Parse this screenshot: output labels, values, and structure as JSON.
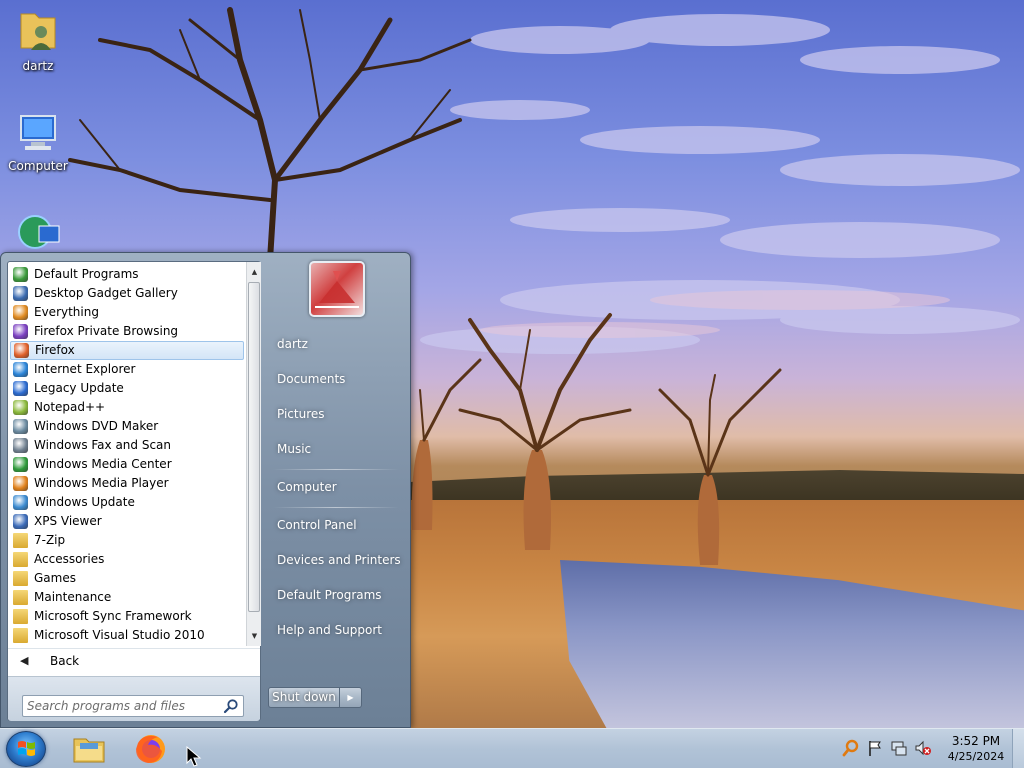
{
  "desktop": {
    "icons": [
      {
        "label": "dartz",
        "icon": "user-folder-icon"
      },
      {
        "label": "Computer",
        "icon": "computer-icon"
      },
      {
        "label": "",
        "icon": "network-icon"
      }
    ]
  },
  "start_menu": {
    "programs": [
      {
        "label": "Default Programs",
        "icon": "default-programs-icon",
        "color": "#3a9a3a"
      },
      {
        "label": "Desktop Gadget Gallery",
        "icon": "gadget-gallery-icon",
        "color": "#3a6ab0"
      },
      {
        "label": "Everything",
        "icon": "everything-search-icon",
        "color": "#e08a20"
      },
      {
        "label": "Firefox Private Browsing",
        "icon": "firefox-private-icon",
        "color": "#7a3fc0"
      },
      {
        "label": "Firefox",
        "icon": "firefox-icon",
        "color": "#e0602a",
        "selected": true
      },
      {
        "label": "Internet Explorer",
        "icon": "internet-explorer-icon",
        "color": "#2a84d8"
      },
      {
        "label": "Legacy Update",
        "icon": "legacy-update-icon",
        "color": "#2a6ad0"
      },
      {
        "label": "Notepad++",
        "icon": "notepadpp-icon",
        "color": "#8ab83a"
      },
      {
        "label": "Windows DVD Maker",
        "icon": "dvd-maker-icon",
        "color": "#6a8aa0"
      },
      {
        "label": "Windows Fax and Scan",
        "icon": "fax-scan-icon",
        "color": "#708090"
      },
      {
        "label": "Windows Media Center",
        "icon": "media-center-icon",
        "color": "#2e9a3a"
      },
      {
        "label": "Windows Media Player",
        "icon": "media-player-icon",
        "color": "#e0801a"
      },
      {
        "label": "Windows Update",
        "icon": "windows-update-icon",
        "color": "#3a8ad0"
      },
      {
        "label": "XPS Viewer",
        "icon": "xps-viewer-icon",
        "color": "#3a6ab8"
      },
      {
        "label": "7-Zip",
        "icon": "folder-icon",
        "folder": true
      },
      {
        "label": "Accessories",
        "icon": "folder-icon",
        "folder": true
      },
      {
        "label": "Games",
        "icon": "folder-icon",
        "folder": true
      },
      {
        "label": "Maintenance",
        "icon": "folder-icon",
        "folder": true
      },
      {
        "label": "Microsoft Sync Framework",
        "icon": "folder-icon",
        "folder": true
      },
      {
        "label": "Microsoft Visual Studio 2010",
        "icon": "folder-icon",
        "folder": true
      }
    ],
    "back_label": "Back",
    "search_placeholder": "Search programs and files",
    "right_items": [
      "dartz",
      "Documents",
      "Pictures",
      "Music",
      "Computer",
      "Control Panel",
      "Devices and Printers",
      "Default Programs",
      "Help and Support"
    ],
    "shutdown_label": "Shut down"
  },
  "taskbar": {
    "pinned": [
      {
        "icon": "file-explorer-icon"
      },
      {
        "icon": "firefox-icon"
      }
    ],
    "clock_time": "3:52 PM",
    "clock_date": "4/25/2024"
  }
}
